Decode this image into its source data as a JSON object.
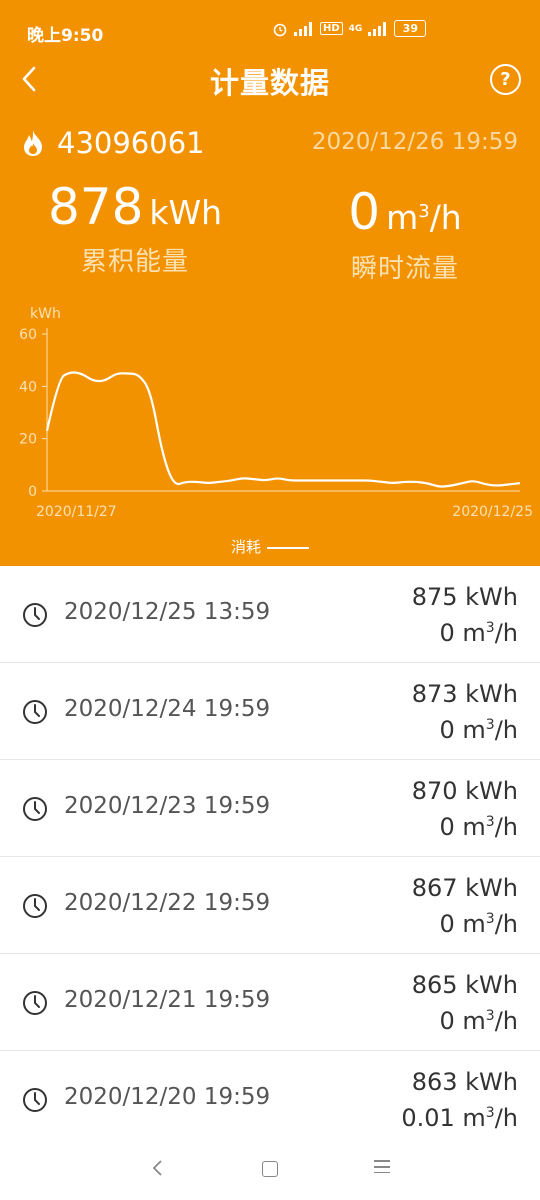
{
  "status_bar": {
    "time": "晚上9:50",
    "network": "4G",
    "hd": "HD",
    "battery": "39"
  },
  "header": {
    "title": "计量数据",
    "help": "?"
  },
  "device": {
    "id": "43096061",
    "timestamp": "2020/12/26 19:59"
  },
  "metrics": {
    "energy": {
      "value": "878",
      "unit": "kWh",
      "label": "累积能量"
    },
    "flow": {
      "value": "0",
      "unit_base": "m",
      "unit_sup": "3",
      "unit_tail": "/h",
      "label": "瞬时流量"
    }
  },
  "chart_data": {
    "type": "line",
    "ylabel": "kWh",
    "ylim": [
      0,
      60
    ],
    "yticks": [
      "60",
      "40",
      "20",
      "0"
    ],
    "x_start_label": "2020/11/27",
    "x_end_label": "2020/12/25",
    "series": [
      {
        "name": "消耗",
        "values": [
          23,
          43,
          45.5,
          45,
          42,
          42,
          45,
          45,
          44.5,
          38,
          14,
          2,
          3.5,
          3.5,
          3,
          3.5,
          4,
          5,
          4.5,
          4,
          5,
          4,
          4,
          4,
          4,
          4,
          4,
          4,
          4,
          3.5,
          3,
          3.5,
          3.5,
          3,
          1.5,
          2,
          3,
          4,
          2.5,
          2,
          2.5,
          3
        ]
      }
    ],
    "grid": false,
    "legend": "bottom-center",
    "color": "#FFFFFF"
  },
  "legend": {
    "label": "消耗"
  },
  "records": [
    {
      "time": "2020/12/25 13:59",
      "energy": "875 kWh",
      "flow_value": "0 m",
      "flow_sup": "3",
      "flow_tail": "/h"
    },
    {
      "time": "2020/12/24 19:59",
      "energy": "873 kWh",
      "flow_value": "0 m",
      "flow_sup": "3",
      "flow_tail": "/h"
    },
    {
      "time": "2020/12/23 19:59",
      "energy": "870 kWh",
      "flow_value": "0 m",
      "flow_sup": "3",
      "flow_tail": "/h"
    },
    {
      "time": "2020/12/22 19:59",
      "energy": "867 kWh",
      "flow_value": "0 m",
      "flow_sup": "3",
      "flow_tail": "/h"
    },
    {
      "time": "2020/12/21 19:59",
      "energy": "865 kWh",
      "flow_value": "0 m",
      "flow_sup": "3",
      "flow_tail": "/h"
    },
    {
      "time": "2020/12/20 19:59",
      "energy": "863 kWh",
      "flow_value": "0.01 m",
      "flow_sup": "3",
      "flow_tail": "/h"
    }
  ],
  "colors": {
    "accent": "#F39200",
    "text_dark": "#333333",
    "text_muted": "#555555"
  },
  "icons": {
    "back": "chevron-left-icon",
    "help": "help-circle-icon",
    "device": "flame-icon",
    "record": "clock-icon"
  }
}
